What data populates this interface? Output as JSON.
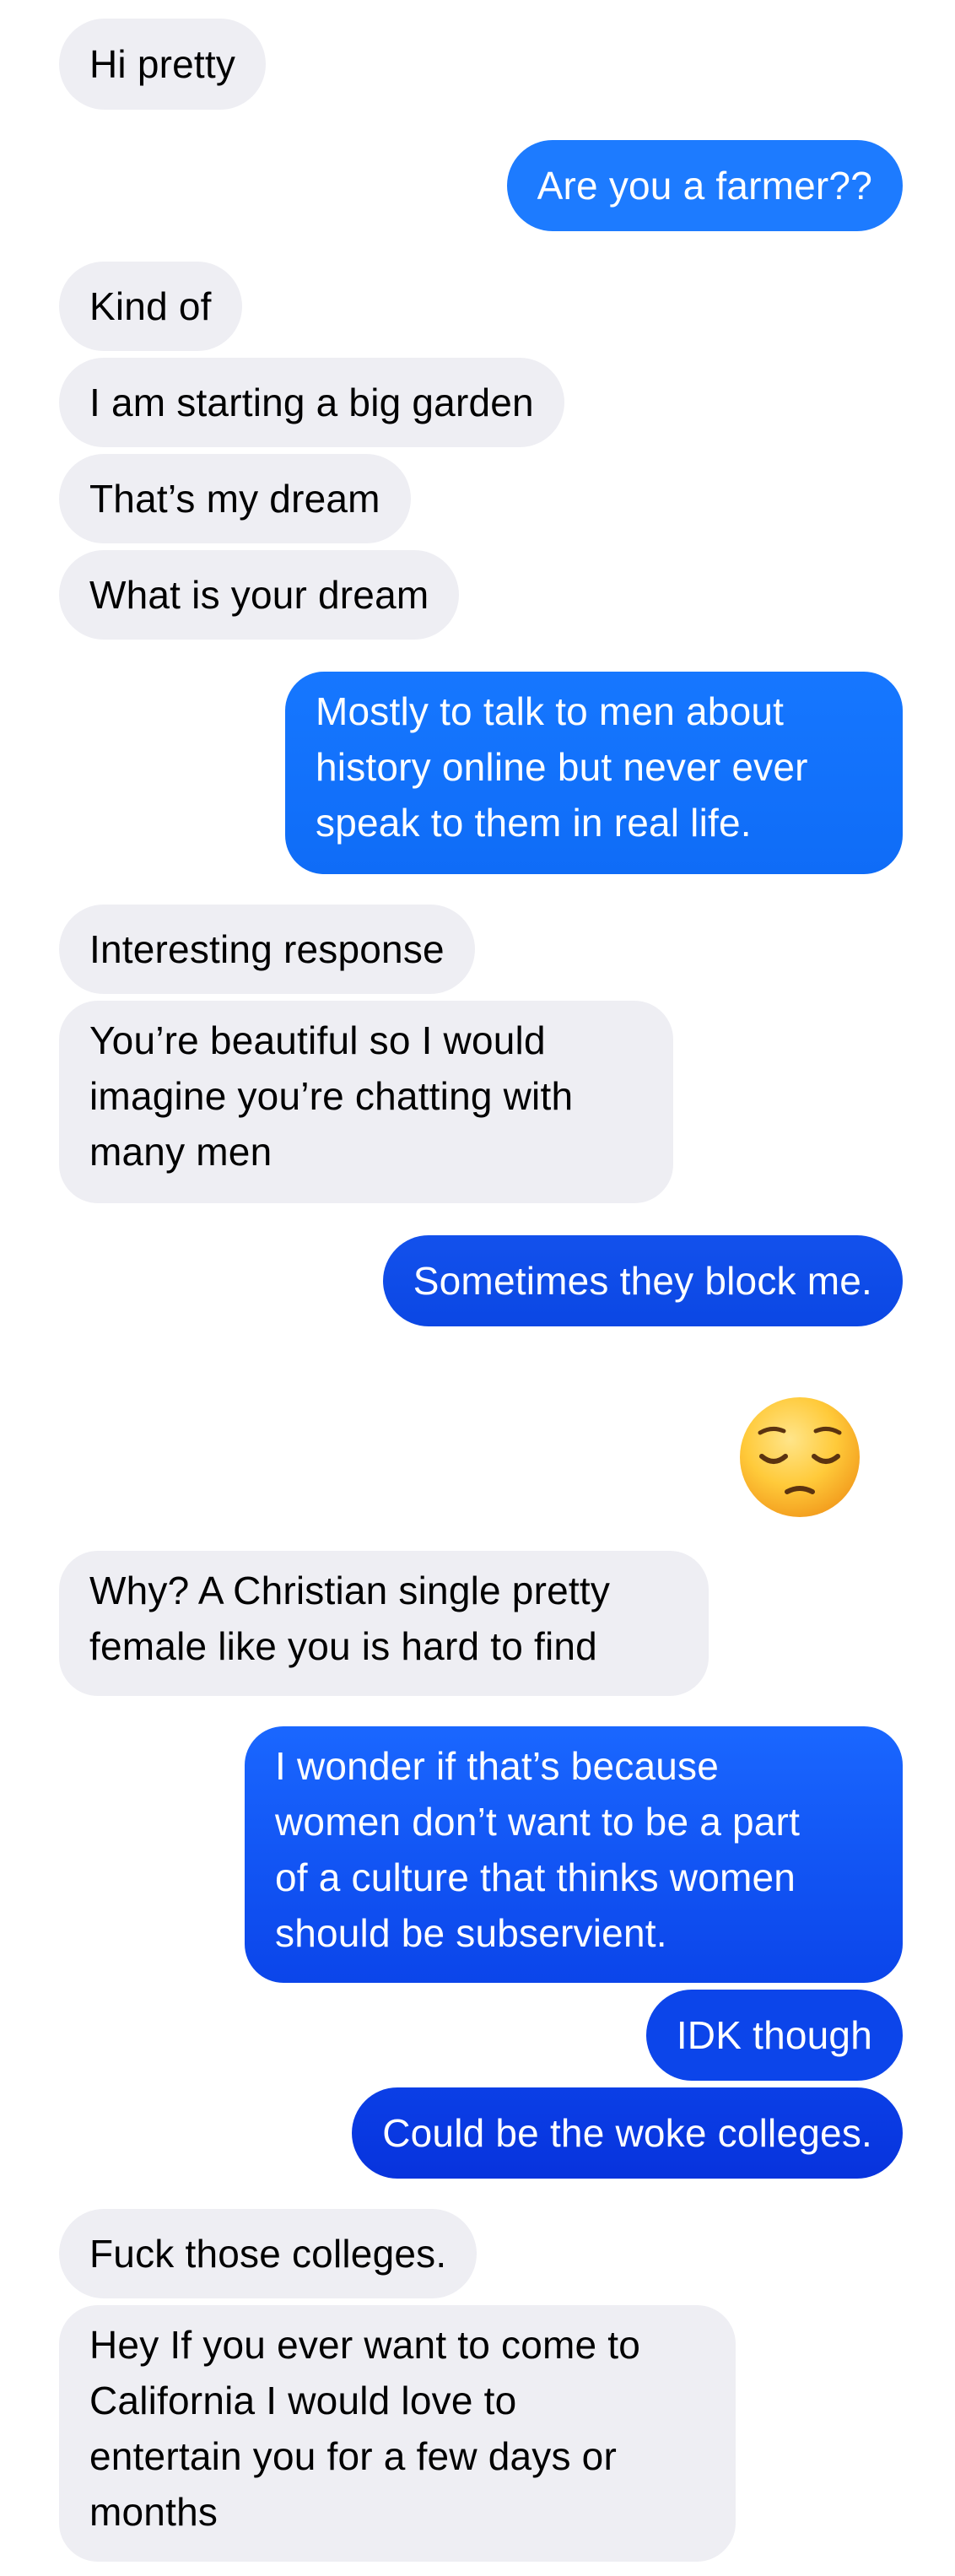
{
  "conversation": {
    "m1": "Hi pretty",
    "m2": "Are you a farmer??",
    "m3": "Kind of",
    "m4": "I am starting a big garden",
    "m5": "That’s my dream",
    "m6": "What is your dream",
    "m7": [
      "Mostly to talk to men about",
      "history online but never ever",
      "speak to them in real life."
    ],
    "m8": "Interesting response",
    "m9": [
      "You’re beautiful so I would",
      "imagine you’re chatting with",
      "many men"
    ],
    "m10": "Sometimes they block me.",
    "m11_emoji": "pensive-face",
    "m12": [
      "Why? A Christian single pretty",
      "female like you is hard to find"
    ],
    "m13": [
      "I wonder if that’s because",
      "women don’t want to be a part",
      "of a culture that thinks women",
      "should be subservient."
    ],
    "m14": "IDK though",
    "m15": "Could be the woke colleges.",
    "m16": "Fuck those colleges.",
    "m17": [
      "Hey If you ever want to come to",
      "California I would love to",
      "entertain you for a few days or",
      "months"
    ]
  },
  "colors": {
    "incoming_bubble": "#eeeef3",
    "outgoing_bubble_top": "#1a7cff",
    "outgoing_bubble_bottom": "#0a3de0"
  }
}
